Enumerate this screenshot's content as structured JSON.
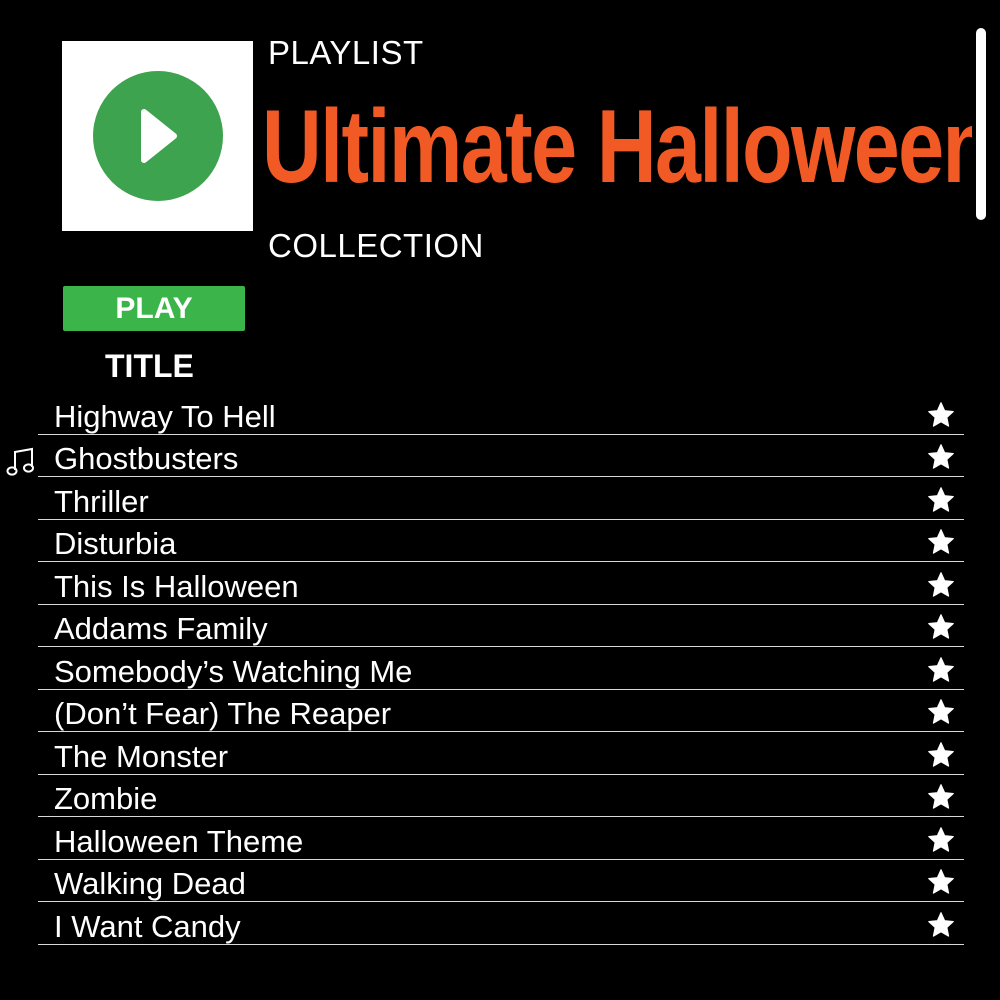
{
  "colors": {
    "background": "#000000",
    "accent_orange": "#f15a24",
    "play_green": "#3bb54a",
    "art_disc_green": "#3da34f",
    "text": "#ffffff"
  },
  "header": {
    "kicker": "PLAYLIST",
    "title": "Ultimate Halloween",
    "subtitle": "COLLECTION"
  },
  "controls": {
    "play_label": "PLAY",
    "art_icon": "play-circle-icon"
  },
  "table": {
    "column_header": "TITLE",
    "now_playing_icon": "music-note-icon",
    "favorite_icon": "star-icon",
    "now_playing_index": 1,
    "tracks": [
      {
        "title": "Highway To Hell"
      },
      {
        "title": "Ghostbusters"
      },
      {
        "title": "Thriller"
      },
      {
        "title": "Disturbia"
      },
      {
        "title": "This Is Halloween"
      },
      {
        "title": "Addams Family"
      },
      {
        "title": "Somebody’s Watching Me"
      },
      {
        "title": "(Don’t Fear) The Reaper"
      },
      {
        "title": "The Monster"
      },
      {
        "title": "Zombie"
      },
      {
        "title": "Halloween Theme"
      },
      {
        "title": "Walking Dead"
      },
      {
        "title": "I Want Candy"
      }
    ]
  }
}
